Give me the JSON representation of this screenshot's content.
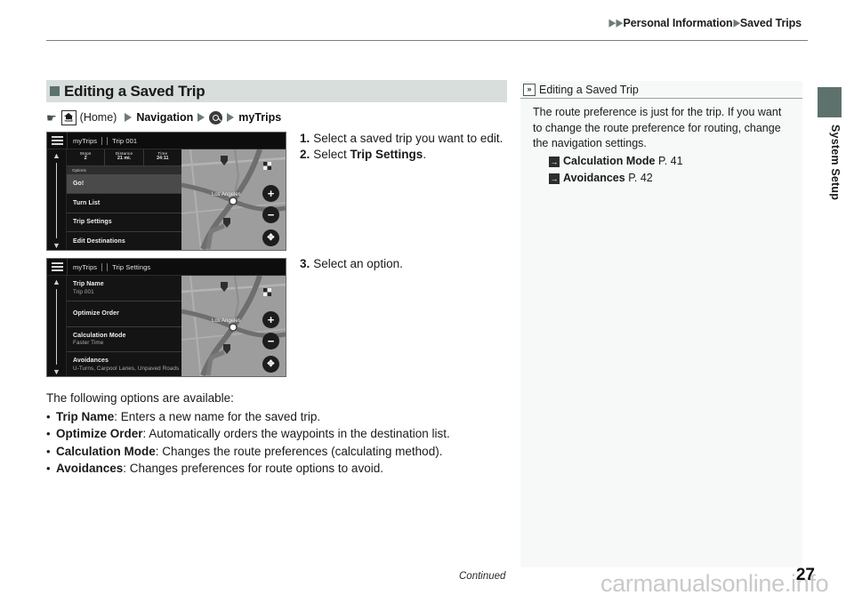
{
  "header": {
    "breadcrumb": [
      "Personal Information",
      "Saved Trips"
    ],
    "breadcrumb_full": "Personal Information  Saved Trips"
  },
  "section": {
    "title": "Editing a Saved Trip",
    "nav_path": {
      "home_icon_word": "HOME",
      "home_label": "(Home)",
      "navigation_label": "Navigation",
      "search_icon": "search-icon",
      "mytrips_label": "myTrips"
    }
  },
  "steps": [
    {
      "num": "1.",
      "text_plain": "Select a saved trip you want to edit."
    },
    {
      "num": "2.",
      "text_prefix": "Select ",
      "text_bold": "Trip Settings",
      "text_suffix": "."
    },
    {
      "num": "3.",
      "text_plain": "Select an option."
    }
  ],
  "screenshot_trip": {
    "menu_icon": "hamburger-menu-icon",
    "crumb_root": "myTrips",
    "crumb_current": "Trip 001",
    "stats": [
      {
        "label": "Stops",
        "value": "2"
      },
      {
        "label": "Distance",
        "value": "21 mi."
      },
      {
        "label": "Time",
        "value": "24:11"
      }
    ],
    "options_bar": "Options",
    "rows": [
      {
        "label": "Go!",
        "highlighted": true
      },
      {
        "label": "Turn List",
        "highlighted": false
      },
      {
        "label": "Trip Settings",
        "highlighted": false
      },
      {
        "label": "Edit Destinations",
        "highlighted": false
      }
    ],
    "map_label": "Los Angeles",
    "map_buttons": [
      "zoom-in-button",
      "zoom-out-button",
      "expand-button"
    ],
    "scroll_up": "▲",
    "scroll_down": "▼"
  },
  "screenshot_settings": {
    "menu_icon": "hamburger-menu-icon",
    "crumb_root": "myTrips",
    "crumb_current": "Trip Settings",
    "rows": [
      {
        "label": "Trip Name",
        "sub": "Trip 001"
      },
      {
        "label": "Optimize Order",
        "sub": ""
      },
      {
        "label": "Calculation Mode",
        "sub": "Faster Time"
      },
      {
        "label": "Avoidances",
        "sub": "U-Turns, Carpool Lanes, Unpaved Roads"
      }
    ],
    "map_label": "Los Angeles",
    "scroll_up": "▲",
    "scroll_down": "▼"
  },
  "options_prose": {
    "lead": "The following options are available:",
    "items": [
      {
        "name": "Trip Name",
        "desc": ": Enters a new name for the saved trip."
      },
      {
        "name": "Optimize Order",
        "desc": ": Automatically orders the waypoints in the destination list."
      },
      {
        "name": "Calculation Mode",
        "desc": ": Changes the route preferences (calculating method)."
      },
      {
        "name": "Avoidances",
        "desc": ": Changes preferences for route options to avoid."
      }
    ]
  },
  "side_note": {
    "icon": "double-chevron-icon",
    "title": "Editing a Saved Trip",
    "body": "The route preference is just for the trip. If you want to change the route preference for routing, change the navigation settings.",
    "xrefs": [
      {
        "name": "Calculation Mode",
        "page": "P. 41"
      },
      {
        "name": "Avoidances",
        "page": "P. 42"
      }
    ]
  },
  "edge_tab": {
    "label": "System Setup",
    "color": "#5d716d"
  },
  "footer": {
    "continued": "Continued",
    "page_number": "27",
    "watermark": "carmanualsonline.info"
  }
}
